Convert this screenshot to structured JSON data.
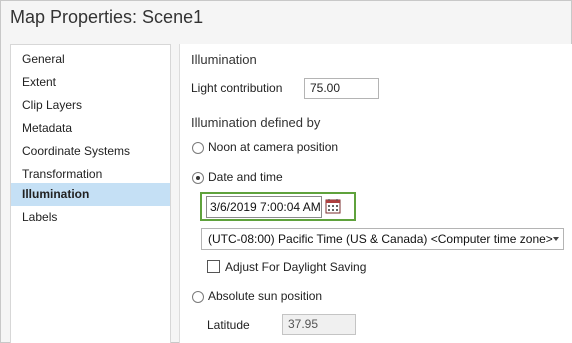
{
  "window": {
    "title": "Map Properties: Scene1"
  },
  "sidebar": {
    "items": [
      {
        "label": "General"
      },
      {
        "label": "Extent"
      },
      {
        "label": "Clip Layers"
      },
      {
        "label": "Metadata"
      },
      {
        "label": "Coordinate Systems"
      },
      {
        "label": "Transformation"
      },
      {
        "label": "Illumination",
        "selected": true
      },
      {
        "label": "Labels"
      }
    ]
  },
  "illumination": {
    "section_title": "Illumination",
    "light_contribution_label": "Light contribution",
    "light_contribution_value": "75.00",
    "defined_by_title": "Illumination defined by",
    "options": {
      "noon": "Noon at camera position",
      "date_time": "Date and time",
      "absolute": "Absolute sun position"
    },
    "selected_option": "date_time",
    "date_time_value": "3/6/2019 7:00:04 AM",
    "timezone_value": "(UTC-08:00) Pacific Time (US & Canada) <Computer time zone>",
    "daylight_saving_label": "Adjust For Daylight Saving",
    "daylight_saving_checked": false,
    "latitude_label": "Latitude",
    "latitude_value": "37.95"
  },
  "colors": {
    "selected_bg": "#c5e0f5",
    "highlight_border": "#5fa23c"
  },
  "icons": {
    "calendar": "calendar-icon"
  }
}
